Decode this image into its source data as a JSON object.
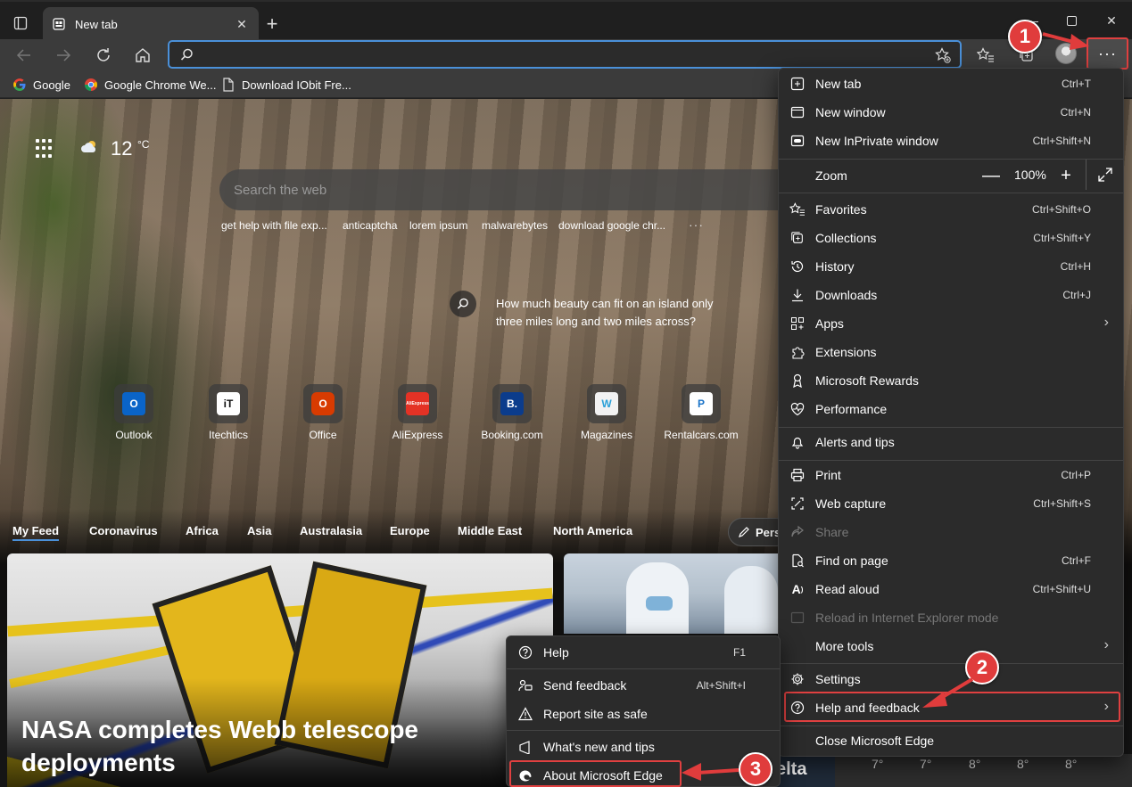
{
  "window": {
    "tab_title": "New tab",
    "controls": {
      "minimize": "—",
      "maximize": "☐",
      "close": "✕"
    }
  },
  "toolbar": {
    "address_value": "",
    "address_placeholder": ""
  },
  "bookmarks": [
    {
      "label": "Google",
      "icon": "google-icon"
    },
    {
      "label": "Google Chrome We...",
      "icon": "chrome-icon"
    },
    {
      "label": "Download IObit Fre...",
      "icon": "page-icon"
    }
  ],
  "ntp": {
    "temperature": "12",
    "temperature_unit": "°C",
    "search_placeholder": "Search the web",
    "suggestions": [
      "get help with file exp...",
      "anticaptcha",
      "lorem ipsum",
      "malwarebytes",
      "download google chr..."
    ],
    "suggestions_more": "···",
    "image_caption": "How much beauty can fit on an island only three miles long and two miles across?",
    "quick_links": [
      {
        "label": "Outlook",
        "glyph": "O",
        "color": "#0a64c8"
      },
      {
        "label": "Itechtics",
        "glyph": "iT",
        "color": "#222222"
      },
      {
        "label": "Office",
        "glyph": "O",
        "color": "#d83b01"
      },
      {
        "label": "AliExpress",
        "glyph": "AliExpress",
        "color": "#e43225"
      },
      {
        "label": "Booking.com",
        "glyph": "B.",
        "color": "#0b3c8c"
      },
      {
        "label": "Magazines",
        "glyph": "W",
        "color": "#f2f2f2"
      },
      {
        "label": "Rentalcars.com",
        "glyph": "P",
        "color": "#1a73c8"
      }
    ],
    "feed_tabs": [
      "My Feed",
      "Coronavirus",
      "Africa",
      "Asia",
      "Australasia",
      "Europe",
      "Middle East",
      "North America"
    ],
    "personalize_label": "Pers",
    "card_title": "NASA completes Webb telescope deployments",
    "card3_text": "elta",
    "weather_temps": [
      "7°",
      "7°",
      "8°",
      "8°",
      "8°"
    ]
  },
  "menu": {
    "items": [
      {
        "label": "New tab",
        "shortcut": "Ctrl+T",
        "icon": "new-tab-icon"
      },
      {
        "label": "New window",
        "shortcut": "Ctrl+N",
        "icon": "new-window-icon"
      },
      {
        "label": "New InPrivate window",
        "shortcut": "Ctrl+Shift+N",
        "icon": "inprivate-icon"
      },
      {
        "label": "Zoom",
        "shortcut": "",
        "icon": ""
      },
      {
        "label": "Favorites",
        "shortcut": "Ctrl+Shift+O",
        "icon": "favorites-icon"
      },
      {
        "label": "Collections",
        "shortcut": "Ctrl+Shift+Y",
        "icon": "collections-icon"
      },
      {
        "label": "History",
        "shortcut": "Ctrl+H",
        "icon": "history-icon"
      },
      {
        "label": "Downloads",
        "shortcut": "Ctrl+J",
        "icon": "download-icon"
      },
      {
        "label": "Apps",
        "shortcut": "",
        "icon": "apps-icon"
      },
      {
        "label": "Extensions",
        "shortcut": "",
        "icon": "extensions-icon"
      },
      {
        "label": "Microsoft Rewards",
        "shortcut": "",
        "icon": "rewards-icon"
      },
      {
        "label": "Performance",
        "shortcut": "",
        "icon": "performance-icon"
      },
      {
        "label": "Alerts and tips",
        "shortcut": "",
        "icon": "bell-icon"
      },
      {
        "label": "Print",
        "shortcut": "Ctrl+P",
        "icon": "print-icon"
      },
      {
        "label": "Web capture",
        "shortcut": "Ctrl+Shift+S",
        "icon": "web-capture-icon"
      },
      {
        "label": "Share",
        "shortcut": "",
        "icon": "share-icon"
      },
      {
        "label": "Find on page",
        "shortcut": "Ctrl+F",
        "icon": "find-icon"
      },
      {
        "label": "Read aloud",
        "shortcut": "Ctrl+Shift+U",
        "icon": "read-aloud-icon"
      },
      {
        "label": "Reload in Internet Explorer mode",
        "shortcut": "",
        "icon": "ie-mode-icon"
      },
      {
        "label": "More tools",
        "shortcut": "",
        "icon": ""
      },
      {
        "label": "Settings",
        "shortcut": "",
        "icon": "gear-icon"
      },
      {
        "label": "Help and feedback",
        "shortcut": "",
        "icon": "help-icon"
      },
      {
        "label": "Close Microsoft Edge",
        "shortcut": "",
        "icon": ""
      }
    ],
    "zoom": {
      "minus": "—",
      "value": "100%",
      "plus": "+"
    }
  },
  "submenu": {
    "items": [
      {
        "label": "Help",
        "shortcut": "F1",
        "icon": "help-icon"
      },
      {
        "label": "Send feedback",
        "shortcut": "Alt+Shift+I",
        "icon": "feedback-icon"
      },
      {
        "label": "Report site as safe",
        "shortcut": "",
        "icon": "warning-icon"
      },
      {
        "label": "What's new and tips",
        "shortcut": "",
        "icon": "tips-icon"
      },
      {
        "label": "About Microsoft Edge",
        "shortcut": "",
        "icon": "edge-icon"
      }
    ]
  },
  "steps": [
    "1",
    "2",
    "3"
  ],
  "colors": {
    "accent": "#4a90d9",
    "highlight": "#e04040",
    "menu_bg": "#2b2b2b"
  }
}
